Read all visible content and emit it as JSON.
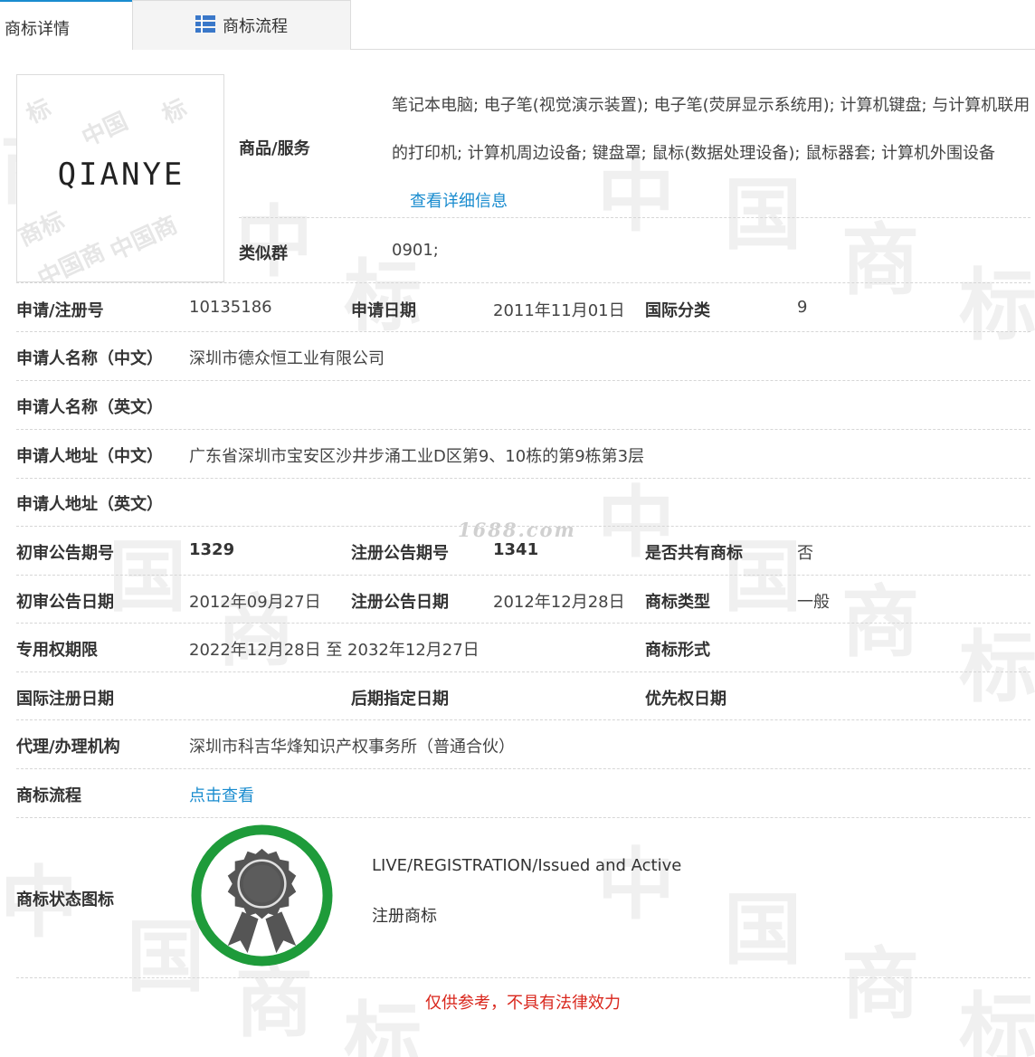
{
  "tabs": {
    "detail": "商标详情",
    "flow": "商标流程"
  },
  "logo": {
    "text": "QIANYE"
  },
  "goods": {
    "label": "商品/服务",
    "text": "笔记本电脑; 电子笔(视觉演示装置); 电子笔(荧屏显示系统用); 计算机键盘; 与计算机联用的打印机; 计算机周边设备; 键盘罩; 鼠标(数据处理设备); 鼠标器套; 计算机外围设备",
    "more_link": "查看详细信息"
  },
  "similar_group": {
    "label": "类似群",
    "value": "0901;"
  },
  "fields": {
    "reg_no": {
      "label": "申请/注册号",
      "value": "10135186"
    },
    "apply_date": {
      "label": "申请日期",
      "value": "2011年11月01日"
    },
    "intl_class": {
      "label": "国际分类",
      "value": "9"
    },
    "applicant_cn": {
      "label": "申请人名称（中文）",
      "value": "深圳市德众恒工业有限公司"
    },
    "applicant_en": {
      "label": "申请人名称（英文）",
      "value": ""
    },
    "address_cn": {
      "label": "申请人地址（中文）",
      "value": "广东省深圳市宝安区沙井步涌工业D区第9、10栋的第9栋第3层"
    },
    "address_en": {
      "label": "申请人地址（英文）",
      "value": ""
    },
    "prelim_issue_no": {
      "label": "初审公告期号",
      "value": "1329"
    },
    "reg_issue_no": {
      "label": "注册公告期号",
      "value": "1341"
    },
    "shared": {
      "label": "是否共有商标",
      "value": "否"
    },
    "prelim_date": {
      "label": "初审公告日期",
      "value": "2012年09月27日"
    },
    "reg_date": {
      "label": "注册公告日期",
      "value": "2012年12月28日"
    },
    "tm_type": {
      "label": "商标类型",
      "value": "一般"
    },
    "exclusive_period": {
      "label": "专用权期限",
      "value": "2022年12月28日 至 2032年12月27日"
    },
    "tm_form": {
      "label": "商标形式",
      "value": ""
    },
    "intl_reg_date": {
      "label": "国际注册日期",
      "value": ""
    },
    "later_date": {
      "label": "后期指定日期",
      "value": ""
    },
    "priority_date": {
      "label": "优先权日期",
      "value": ""
    },
    "agent": {
      "label": "代理/办理机构",
      "value": "深圳市科吉华烽知识产权事务所（普通合伙）"
    },
    "flow": {
      "label": "商标流程",
      "value": "点击查看"
    }
  },
  "status": {
    "label": "商标状态图标",
    "line1": "LIVE/REGISTRATION/Issued and Active",
    "line2": "注册商标"
  },
  "watermark_site": "1688.com",
  "disclaimer": "仅供参考，不具有法律效力",
  "colors": {
    "link": "#1a8ccf",
    "badge_ring": "#1e9b3a",
    "badge_medal": "#555555",
    "disclaimer": "#d9261c",
    "tab_icon": "#3a78c9"
  }
}
